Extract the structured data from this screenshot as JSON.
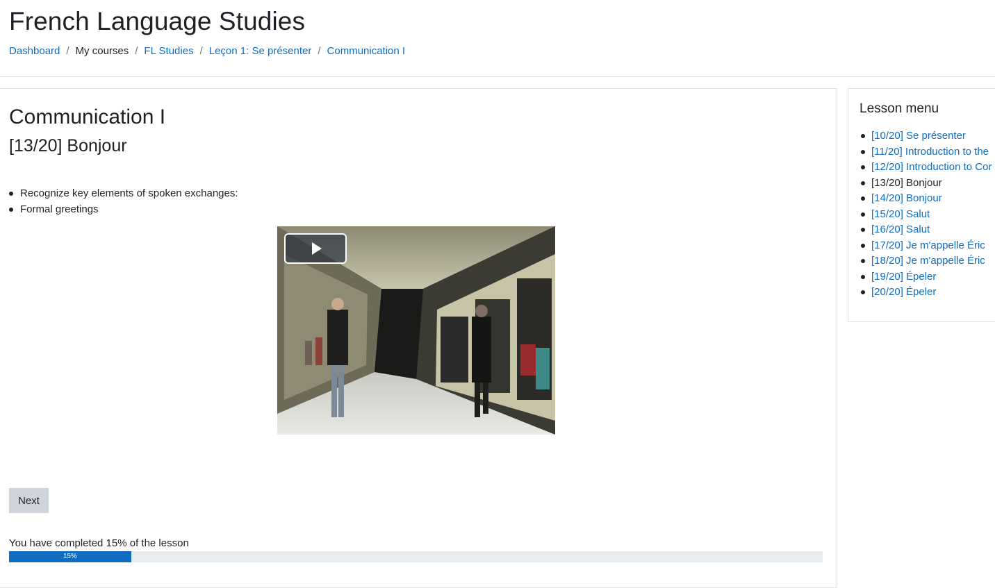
{
  "header": {
    "site_title": "French Language Studies",
    "breadcrumb": [
      {
        "label": "Dashboard",
        "link": true
      },
      {
        "label": "My courses",
        "link": false
      },
      {
        "label": "FL Studies",
        "link": true
      },
      {
        "label": "Leçon 1: Se présenter",
        "link": true
      },
      {
        "label": "Communication I",
        "link": true
      }
    ]
  },
  "main": {
    "lesson_title": "Communication I",
    "page_title": "[13/20] Bonjour",
    "objectives": [
      "Recognize key elements of spoken exchanges:",
      "Formal greetings"
    ],
    "video": {
      "play_icon": "play-icon"
    },
    "next_label": "Next",
    "progress": {
      "text": "You have completed 15% of the lesson",
      "label": "15%",
      "value": 15
    }
  },
  "sidebar": {
    "title": "Lesson menu",
    "items": [
      {
        "label": "[10/20] Se présenter",
        "current": false
      },
      {
        "label": "[11/20] Introduction to the",
        "current": false
      },
      {
        "label": "[12/20] Introduction to Cor",
        "current": false
      },
      {
        "label": "[13/20] Bonjour",
        "current": true
      },
      {
        "label": "[14/20] Bonjour",
        "current": false
      },
      {
        "label": "[15/20] Salut",
        "current": false
      },
      {
        "label": "[16/20] Salut",
        "current": false
      },
      {
        "label": "[17/20] Je m'appelle Éric",
        "current": false
      },
      {
        "label": "[18/20] Je m'appelle Éric",
        "current": false
      },
      {
        "label": "[19/20] Épeler",
        "current": false
      },
      {
        "label": "[20/20] Épeler",
        "current": false
      }
    ]
  },
  "colors": {
    "link": "#0f6cbf",
    "progress": "#0f6cbf",
    "track": "#e9ecef",
    "button": "#ced4da"
  }
}
